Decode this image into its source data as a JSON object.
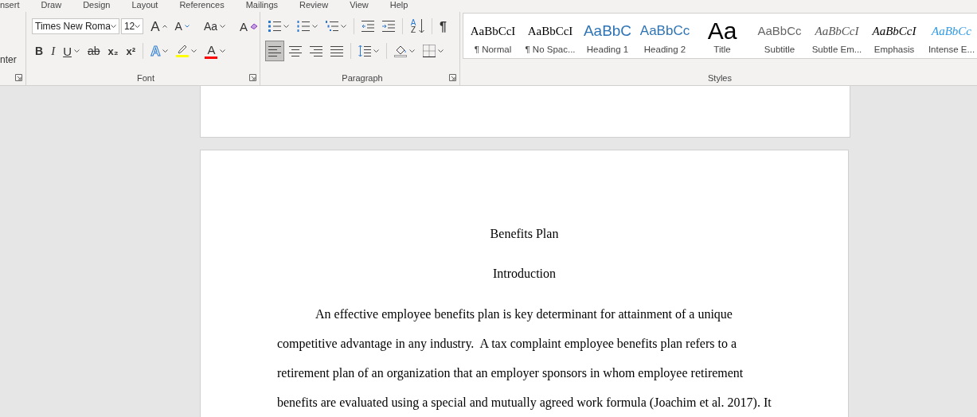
{
  "tabs": [
    {
      "label": "nsert"
    },
    {
      "label": "Draw"
    },
    {
      "label": "Design"
    },
    {
      "label": "Layout"
    },
    {
      "label": "References"
    },
    {
      "label": "Mailings"
    },
    {
      "label": "Review"
    },
    {
      "label": "View"
    },
    {
      "label": "Help"
    }
  ],
  "clipboard": {
    "label": "nter"
  },
  "font": {
    "group_label": "Font",
    "name": "Times New Roma",
    "size": "12",
    "row1": [
      {
        "kind": "grow",
        "glyph": "A"
      },
      {
        "kind": "shrink",
        "glyph": "A"
      },
      {
        "kind": "separator"
      },
      {
        "kind": "change_case",
        "glyph": "Aa",
        "dropdown": true
      },
      {
        "kind": "separator"
      },
      {
        "kind": "clear",
        "glyph": "A"
      }
    ],
    "row2": [
      {
        "kind": "bold",
        "glyph": "B"
      },
      {
        "kind": "italic",
        "glyph": "I"
      },
      {
        "kind": "underline",
        "glyph": "U",
        "dropdown": true
      },
      {
        "kind": "strike",
        "glyph": "ab"
      },
      {
        "kind": "subscript",
        "glyph": "x₂"
      },
      {
        "kind": "superscript",
        "glyph": "x²"
      },
      {
        "kind": "separator"
      },
      {
        "kind": "text_effects",
        "glyph": "A",
        "dropdown": true
      },
      {
        "kind": "highlight",
        "color": "#ffff00",
        "dropdown": true
      },
      {
        "kind": "font_color",
        "glyph": "A",
        "color": "#ff0000",
        "dropdown": true
      }
    ]
  },
  "paragraph": {
    "group_label": "Paragraph",
    "row1": [
      {
        "kind": "bullets",
        "dropdown": true
      },
      {
        "kind": "numbering",
        "dropdown": true
      },
      {
        "kind": "multilevel",
        "dropdown": true
      },
      {
        "kind": "separator"
      },
      {
        "kind": "decrease_indent"
      },
      {
        "kind": "increase_indent"
      },
      {
        "kind": "separator"
      },
      {
        "kind": "sort",
        "glyph": "AZ"
      },
      {
        "kind": "separator"
      },
      {
        "kind": "pilcrow",
        "glyph": "¶"
      }
    ],
    "row2": [
      {
        "kind": "align_left",
        "selected": true
      },
      {
        "kind": "align_center",
        "selected": false
      },
      {
        "kind": "align_right",
        "selected": false
      },
      {
        "kind": "justify",
        "selected": false
      },
      {
        "kind": "separator"
      },
      {
        "kind": "line_spacing",
        "dropdown": true
      },
      {
        "kind": "separator"
      },
      {
        "kind": "shading",
        "dropdown": true
      },
      {
        "kind": "borders",
        "dropdown": true
      }
    ]
  },
  "styles": {
    "group_label": "Styles",
    "items": [
      {
        "kind": "normal",
        "preview": "AaBbCcI",
        "name": "¶ Normal"
      },
      {
        "kind": "no_spacing",
        "preview": "AaBbCcI",
        "name": "¶ No Spac..."
      },
      {
        "kind": "heading1",
        "preview": "AaBbC",
        "name": "Heading 1"
      },
      {
        "kind": "heading2",
        "preview": "AaBbCc",
        "name": "Heading 2"
      },
      {
        "kind": "title",
        "preview": "Aa",
        "name": "Title"
      },
      {
        "kind": "subtitle",
        "preview": "AaBbCc",
        "name": "Subtitle"
      },
      {
        "kind": "subtle_emphasis",
        "preview": "AaBbCcI",
        "name": "Subtle Em..."
      },
      {
        "kind": "emphasis",
        "preview": "AaBbCcI",
        "name": "Emphasis"
      },
      {
        "kind": "intense_emphasis",
        "preview": "AaBbCc",
        "name": "Intense E..."
      }
    ]
  },
  "document": {
    "title": "Benefits Plan",
    "heading": "Introduction",
    "paragraph": "An effective employee benefits plan is key determinant for attainment of a unique competitive advantage in any industry.  A tax complaint employee benefits plan refers to a retirement plan of an organization that an employer sponsors in whom employee retirement benefits are evaluated using a special and mutually agreed work formula (Joachim et al. 2017). It"
  }
}
